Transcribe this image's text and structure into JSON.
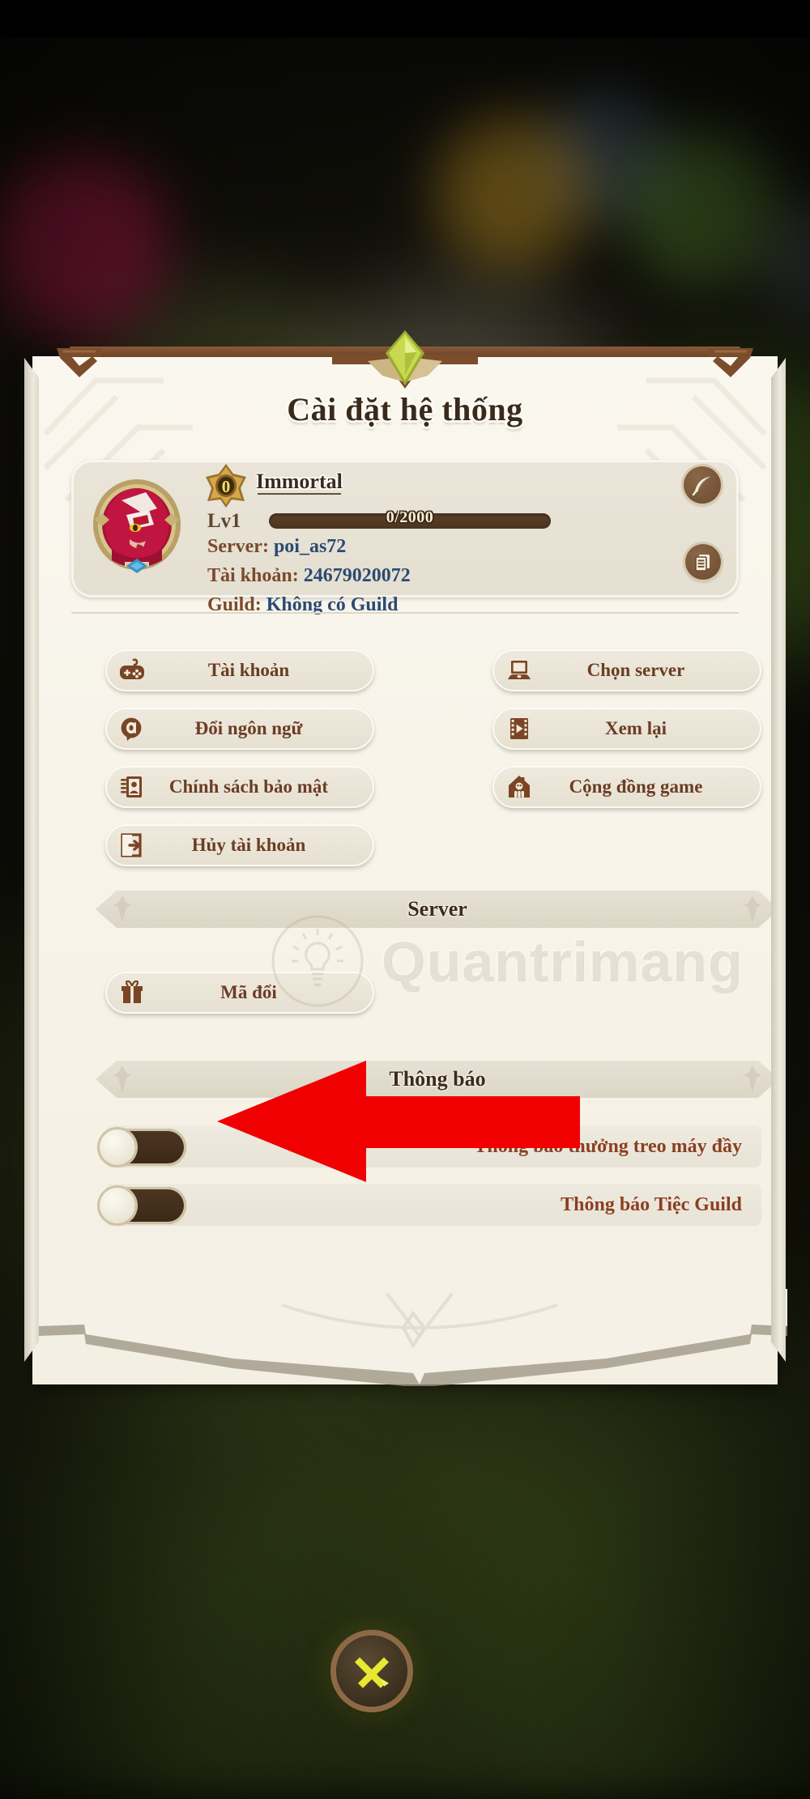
{
  "window": {
    "title": "Cài đặt hệ thống"
  },
  "profile": {
    "rank_badge": "0",
    "name": "Immortal",
    "level_label": "Lv1",
    "xp_text": "0/2000",
    "xp_percent": 0,
    "rows": [
      {
        "key": "Server:",
        "value": "poi_as72"
      },
      {
        "key": "Tài khoản:",
        "value": "24679020072"
      },
      {
        "key": "Guild:",
        "value": "Không có Guild"
      }
    ],
    "edit_icon": "quill-icon",
    "copy_icon": "copy-icon",
    "avatar_icon": "player-avatar"
  },
  "menu": {
    "buttons": [
      {
        "label": "Tài khoản",
        "icon": "gamepad-icon"
      },
      {
        "label": "Chọn server",
        "icon": "laptop-icon"
      },
      {
        "label": "Đổi ngôn ngữ",
        "icon": "speech-bubble-icon"
      },
      {
        "label": "Xem lại",
        "icon": "film-icon"
      },
      {
        "label": "Chính sách bảo mật",
        "icon": "contact-book-icon"
      },
      {
        "label": "Cộng đồng game",
        "icon": "house-icon"
      },
      {
        "label": "Hủy tài khoản",
        "icon": "exit-door-icon"
      }
    ]
  },
  "sections": {
    "server_banner": "Server",
    "notify_banner": "Thông báo"
  },
  "redeem": {
    "label": "Mã đổi",
    "icon": "gift-icon"
  },
  "toggles": [
    {
      "label": "Thông báo thưởng treo máy đầy",
      "state": "off"
    },
    {
      "label": "Thông báo Tiệc Guild",
      "state": "off"
    }
  ],
  "watermark": {
    "text": "Quantrimang",
    "logo": "lightbulb-logo"
  },
  "annotation": {
    "arrow": "red-pointer-arrow",
    "points_at": "Mã đổi"
  },
  "footer": {
    "close_label": "close-button",
    "icon": "x-icon"
  },
  "colors": {
    "paper": "#f7f3e8",
    "wood_trim": "#6d4427",
    "gem_green": "#b9cf4a",
    "label_brown": "#6a3d24",
    "value_blue": "#2b4a72",
    "toggle_track": "#3c2817",
    "arrow_red": "#f00000",
    "close_yellow": "#e8e831"
  }
}
